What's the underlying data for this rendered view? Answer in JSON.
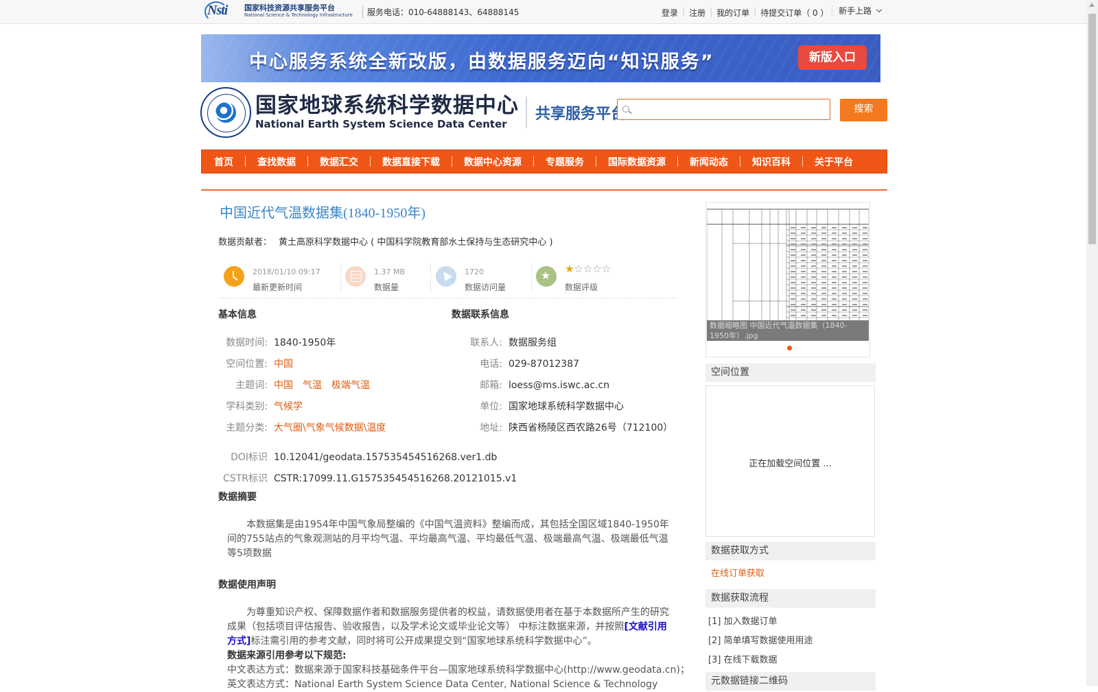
{
  "topbar": {
    "logo_cn": "国家科技资源共享服务平台",
    "logo_en": "National Science & Technology Infrastructure",
    "logo_mark": "Nsti",
    "hotline_label": "服务电话：",
    "hotline_value": "010-64888143、64888145",
    "links": [
      "登录",
      "注册",
      "我的订单",
      "待提交订单（ 0 ）"
    ],
    "guide": "新手上路"
  },
  "banner": {
    "text": "中心服务系统全新改版，由数据服务迈向“知识服务”",
    "button": "新版入口"
  },
  "header": {
    "center_cn": "国家地球系统科学数据中心",
    "center_en": "National Earth System Science Data Center",
    "platform": "共享服务平台",
    "search_placeholder": "",
    "search_button": "搜索"
  },
  "nav": [
    "首页",
    "查找数据",
    "数据汇交",
    "数据直接下载",
    "数据中心资源",
    "专题服务",
    "国际数据资源",
    "新闻动态",
    "知识百科",
    "关于平台"
  ],
  "dataset": {
    "title": "中国近代气温数据集(1840-1950年)",
    "contributor_label": "数据贡献者：",
    "contributor": "黄土高原科学数据中心 ( 中国科学院教育部水土保持与生态研究中心 )"
  },
  "stats": {
    "updated": {
      "value": "2018/01/10 09:17",
      "label": "最新更新时间"
    },
    "size": {
      "value": "1.37 MB",
      "label": "数据量"
    },
    "visits": {
      "value": "1720",
      "label": "数据访问量"
    },
    "rating": {
      "label": "数据评级",
      "stars": 1,
      "max": 5
    }
  },
  "basic_info": {
    "heading": "基本信息",
    "time_label": "数据时间:",
    "time": "1840-1950年",
    "space_label": "空间位置:",
    "space": "中国",
    "keywords_label": "主题词:",
    "keywords": [
      "中国",
      "气温",
      "极端气温"
    ],
    "discipline_label": "学科类别:",
    "discipline": "气候学",
    "category_label": "主题分类:",
    "category": "大气圈\\气象气候数据\\温度",
    "doi_label": "DOI标识",
    "doi": "10.12041/geodata.157535454516268.ver1.db",
    "cstr_label": "CSTR标识",
    "cstr": "CSTR:17099.11.G157535454516268.20121015.v1"
  },
  "contact_info": {
    "heading": "数据联系信息",
    "contact_label": "联系人:",
    "contact": "数据服务组",
    "phone_label": "电话:",
    "phone": "029-87012387",
    "email_label": "邮箱:",
    "email": "loess@ms.iswc.ac.cn",
    "org_label": "单位:",
    "org": "国家地球系统科学数据中心",
    "address_label": "地址:",
    "address": "陕西省杨陵区西农路26号（712100）"
  },
  "abstract": {
    "heading": "数据摘要",
    "text": "本数据集是由1954年中国气象局整编的《中国气温资料》整编而成，其包括全国区域1840-1950年间的755站点的气象观测站的月平均气温、平均最高气温、平均最低气温、极端最高气温、极端最低气温等5项数据"
  },
  "usage": {
    "heading": "数据使用声明",
    "text_before": "为尊重知识产权、保障数据作者和数据服务提供者的权益，请数据使用者在基于本数据所产生的研究成果（包括项目评估报告、验收报告，以及学术论文或毕业论文等） 中标注数据来源，并按照",
    "cite_link": "[文献引用方式]",
    "text_after": "标注需引用的参考文献，同时将可公开成果提交到“国家地球系统科学数据中心”。",
    "rules_heading": "数据来源引用参考以下规范:",
    "cn_line": "中文表达方式：数据来源于国家科技基础条件平台—国家地球系统科学数据中心(http://www.geodata.cn)；",
    "en_line": "英文表达方式：National Earth System Science Data Center, National Science & Technology"
  },
  "sidebar": {
    "thumb_caption": "数据缩略图  中国近代气温数据集（1840-1950年）.jpg",
    "space_heading": "空间位置",
    "map_loading": "正在加载空间位置 ...",
    "access_heading": "数据获取方式",
    "access_link": "在线订单获取",
    "process_heading": "数据获取流程",
    "steps": [
      "[1] 加入数据订单",
      "[2] 简单填写数据使用用途",
      "[3] 在线下载数据"
    ],
    "qr_heading": "元数据链接二维码"
  },
  "colors": {
    "accent_orange": "#f05616",
    "title_blue": "#3a86c7",
    "banner_blue": "#3e6ad0",
    "banner_button": "#e84a3f"
  }
}
